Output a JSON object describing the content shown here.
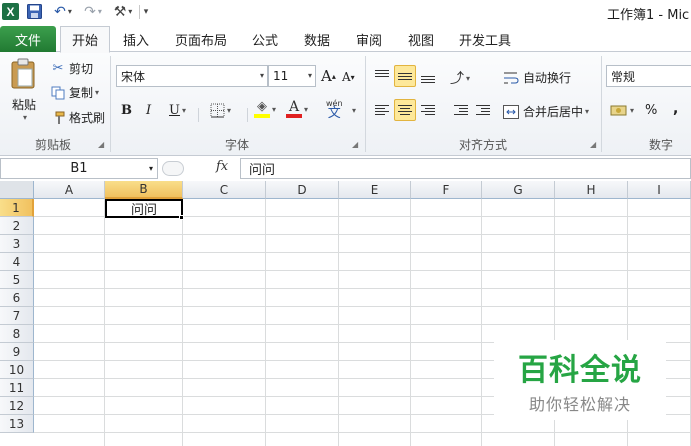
{
  "window": {
    "title": "工作簿1 - Mic"
  },
  "quick_access": {
    "app_icon": "excel-logo-icon",
    "save_icon": "save-icon",
    "undo_icon": "undo-icon",
    "redo_icon": "redo-icon",
    "tool_icon": "customize-tool-icon",
    "app_letter": "X"
  },
  "tabs": {
    "file": "文件",
    "items": [
      "开始",
      "插入",
      "页面布局",
      "公式",
      "数据",
      "审阅",
      "视图",
      "开发工具"
    ],
    "active": "开始"
  },
  "ribbon": {
    "clipboard": {
      "paste": "粘贴",
      "cut": "剪切",
      "copy": "复制",
      "format_painter": "格式刷",
      "label": "剪贴板"
    },
    "font": {
      "name": "宋体",
      "size": "11",
      "bold": "B",
      "italic": "I",
      "underline": "U",
      "grow": "A",
      "shrink": "A",
      "font_color_letter": "A",
      "phonetic": "wén",
      "phonetic_char": "文",
      "label": "字体",
      "font_color": "#e02020",
      "fill_color": "#ffff00"
    },
    "alignment": {
      "wrap_text": "自动换行",
      "merge_center": "合并后居中",
      "label": "对齐方式"
    },
    "number": {
      "format": "常规",
      "percent": "%",
      "comma": ",",
      "label": "数字"
    }
  },
  "formula_bar": {
    "name_box": "B1",
    "fx": "fx",
    "content": "问问"
  },
  "grid": {
    "columns": [
      "A",
      "B",
      "C",
      "D",
      "E",
      "F",
      "G",
      "H",
      "I"
    ],
    "rows": [
      "1",
      "2",
      "3",
      "4",
      "5",
      "6",
      "7",
      "8",
      "9",
      "10",
      "11",
      "12",
      "13"
    ],
    "selected_cell": "B1",
    "b1_value": "问问"
  },
  "watermark": {
    "title": "百科全说",
    "subtitle": "助你轻松解决"
  },
  "colors": {
    "file_tab": "#2d8a3e",
    "selection_header": "#f1c15f",
    "watermark_green": "#26a544"
  }
}
